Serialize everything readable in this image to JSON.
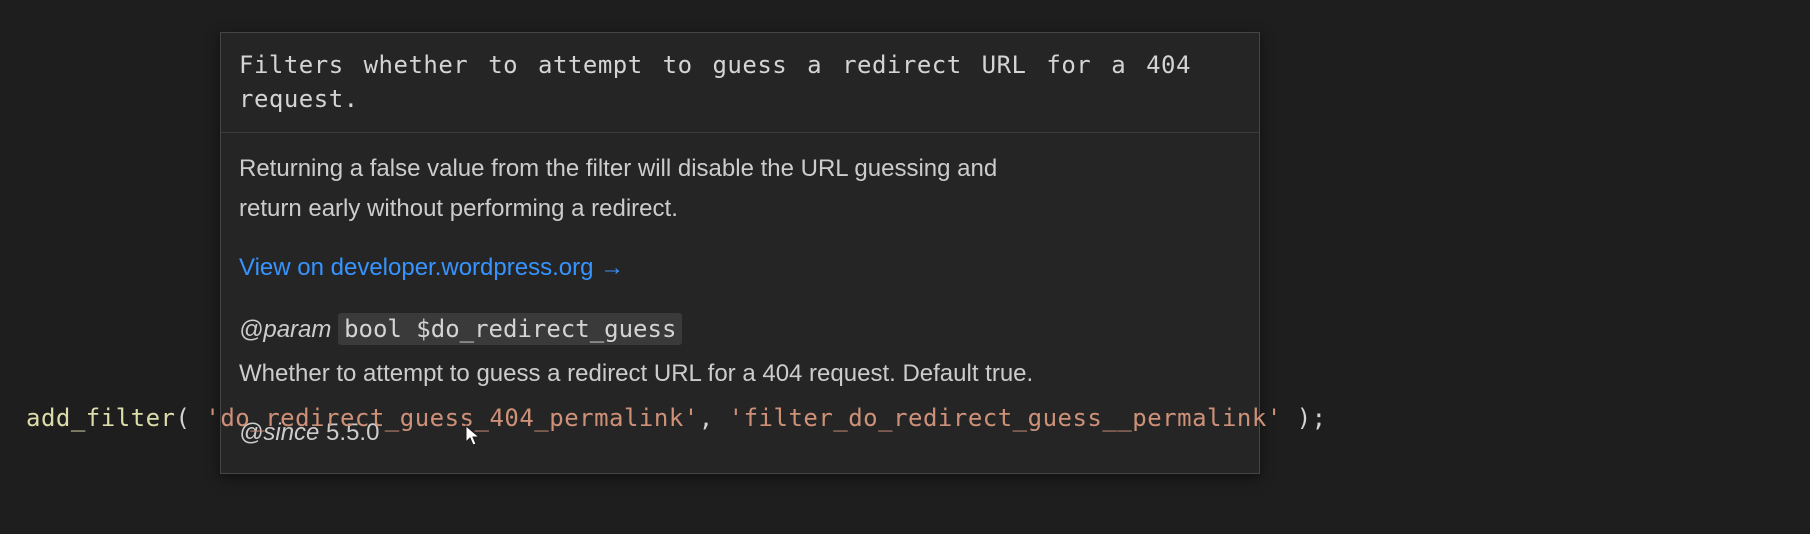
{
  "tooltip": {
    "summary": "Filters whether to attempt to guess a redirect URL for a 404 request.",
    "description_line1": "Returning a false value from the filter will disable the URL guessing and",
    "description_line2": "return early without performing a redirect.",
    "link_text": "View on developer.wordpress.org →",
    "link_url": "https://developer.wordpress.org",
    "param": {
      "tag": "@param",
      "type_and_var": "bool $do_redirect_guess",
      "description": "Whether to attempt to guess a redirect URL for a 404 request. Default true."
    },
    "since": {
      "tag": "@since",
      "version": " 5.5.0"
    }
  },
  "code": {
    "fn": "add_filter",
    "open": "( ",
    "arg1": "'do_redirect_guess_404_permalink'",
    "comma": ", ",
    "arg2": "'filter_do_redirect_guess__permalink'",
    "close": " );"
  }
}
